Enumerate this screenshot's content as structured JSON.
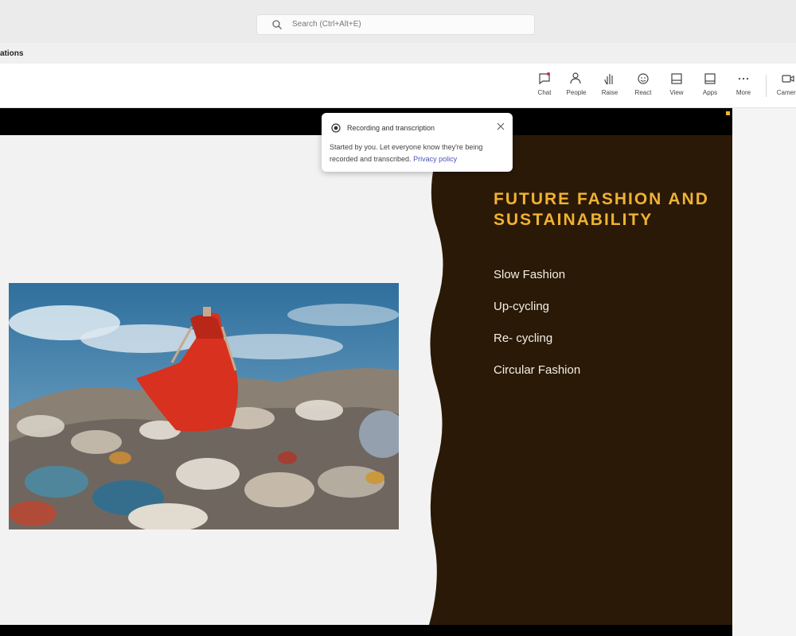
{
  "search": {
    "placeholder": "Search (Ctrl+Alt+E)"
  },
  "meeting": {
    "title": "ations"
  },
  "toolbar": {
    "items": [
      {
        "label": "Chat",
        "icon": "chat-icon"
      },
      {
        "label": "People",
        "icon": "people-icon"
      },
      {
        "label": "Raise",
        "icon": "raise-hand-icon"
      },
      {
        "label": "React",
        "icon": "react-icon"
      },
      {
        "label": "View",
        "icon": "view-icon"
      },
      {
        "label": "Apps",
        "icon": "apps-icon"
      },
      {
        "label": "More",
        "icon": "more-icon"
      },
      {
        "label": "Camera",
        "icon": "camera-icon"
      }
    ]
  },
  "toast": {
    "title": "Recording and transcription",
    "body": "Started by you. Let everyone know they're being recorded and transcribed.",
    "link": "Privacy policy"
  },
  "slide": {
    "title": "FUTURE FASHION AND SUSTAINABILITY",
    "bullets": [
      "Slow Fashion",
      "Up-cycling",
      "Re- cycling",
      "Circular Fashion"
    ],
    "colors": {
      "panel": "#2a1906",
      "title": "#f0b233",
      "text": "#f4efe6"
    },
    "image": "woman-in-red-dress-on-clothing-landfill"
  }
}
